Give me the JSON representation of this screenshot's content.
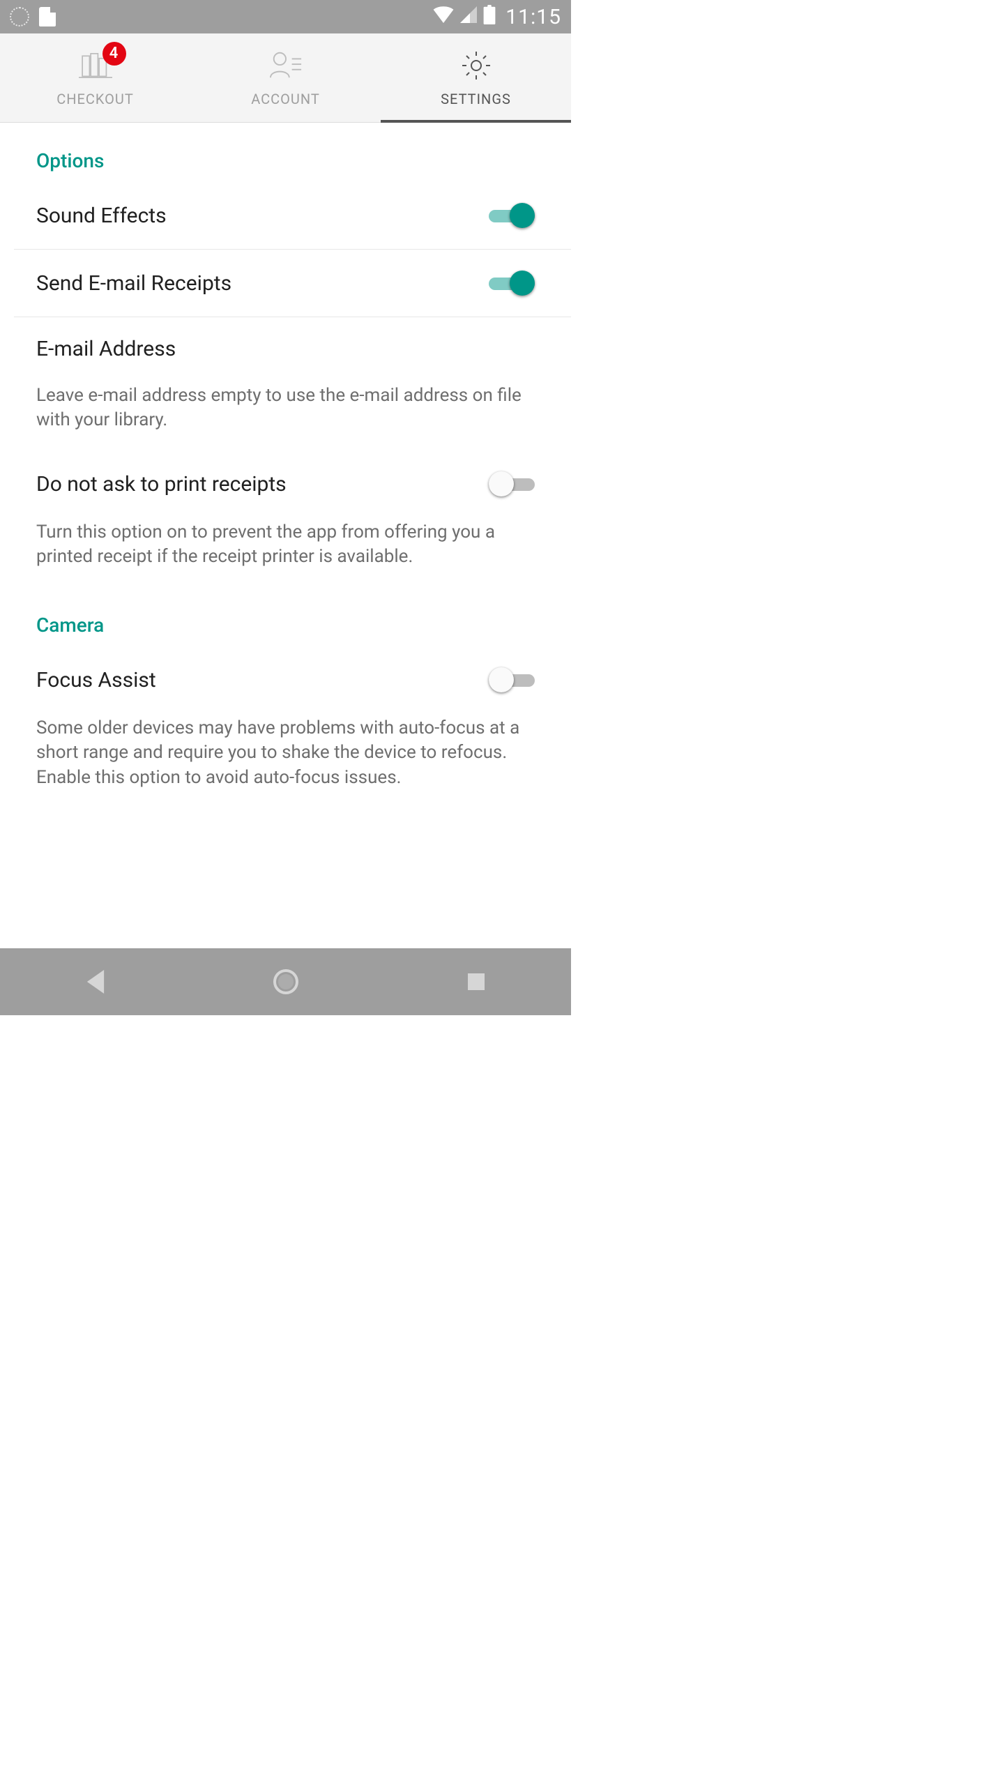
{
  "status": {
    "time": "11:15"
  },
  "tabs": {
    "checkout": {
      "label": "CHECKOUT",
      "badge": "4"
    },
    "account": {
      "label": "ACCOUNT"
    },
    "settings": {
      "label": "SETTINGS"
    }
  },
  "sections": {
    "options": {
      "title": "Options",
      "sound_effects": {
        "label": "Sound Effects",
        "on": true
      },
      "send_email": {
        "label": "Send E-mail Receipts",
        "on": true
      },
      "email_address": {
        "label": "E-mail Address",
        "helper": "Leave e-mail address empty to use the e-mail address on file with your library."
      },
      "no_print": {
        "label": "Do not ask to print receipts",
        "on": false,
        "helper": "Turn this option on to prevent the app from offering you a printed receipt if the receipt printer is available."
      }
    },
    "camera": {
      "title": "Camera",
      "focus_assist": {
        "label": "Focus Assist",
        "on": false,
        "helper": "Some older devices may have problems with auto-focus at a short range and require you to shake the device to refocus. Enable this option to avoid auto-focus issues."
      }
    }
  }
}
